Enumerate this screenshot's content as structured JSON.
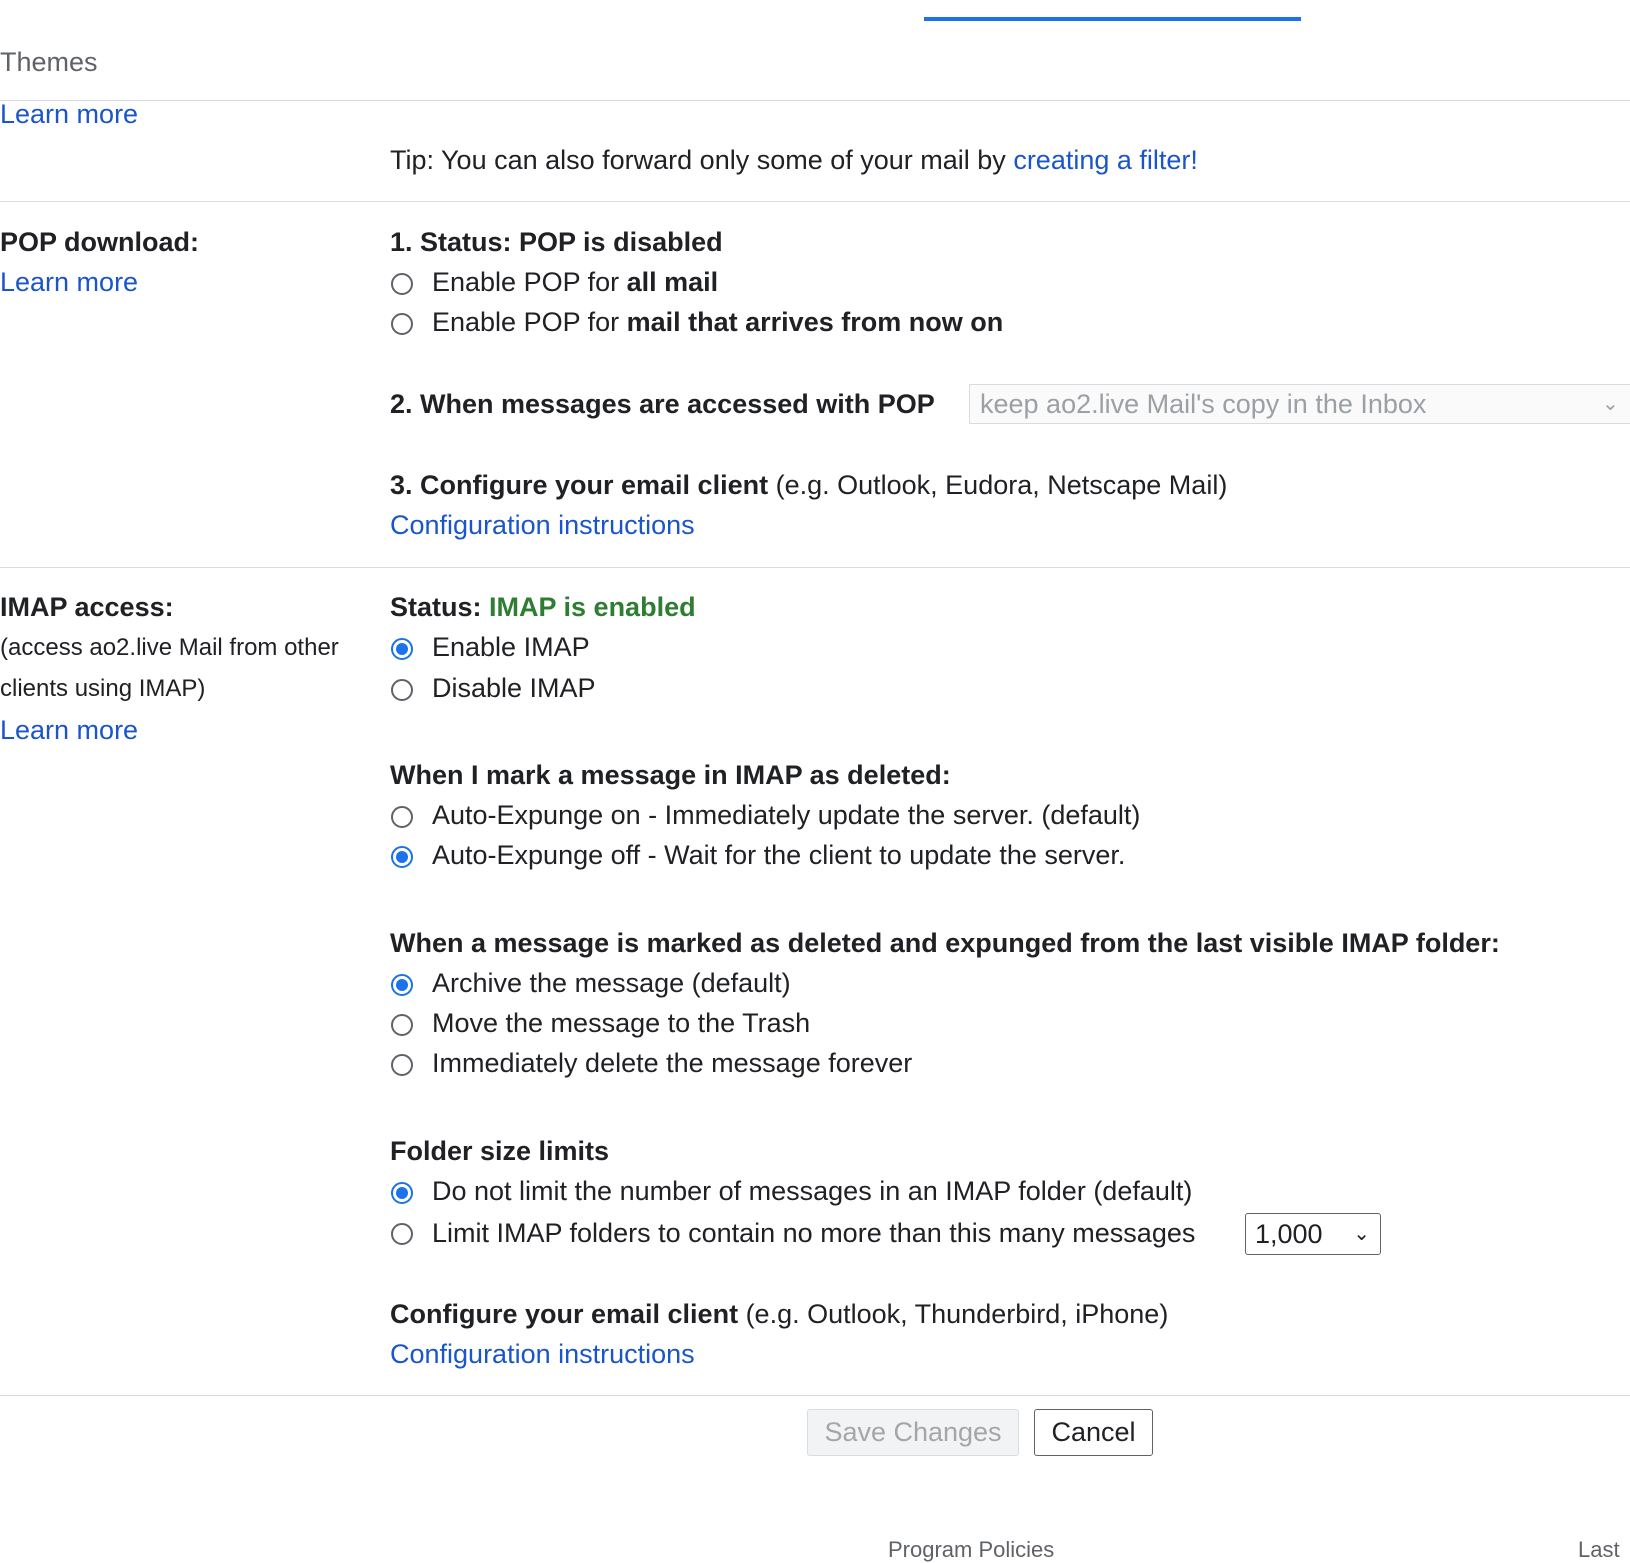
{
  "header": {
    "themes_tab": "Themes",
    "learn_more": "Learn more"
  },
  "forwarding": {
    "tip_prefix": "Tip: You can also forward only some of your mail by ",
    "tip_link": "creating a filter!"
  },
  "pop": {
    "label": "POP download:",
    "learn_more": "Learn more",
    "status": "1. Status: POP is disabled",
    "option_all_prefix": "Enable POP for ",
    "option_all_bold": "all mail",
    "option_now_prefix": "Enable POP for ",
    "option_now_bold": "mail that arrives from now on",
    "accessed_label": "2. When messages are accessed with POP",
    "accessed_value": "keep ao2.live Mail's copy in the Inbox",
    "configure_bold": "3. Configure your email client",
    "configure_rest": " (e.g. Outlook, Eudora, Netscape Mail)",
    "config_link": "Configuration instructions"
  },
  "imap": {
    "label": "IMAP access:",
    "desc_line1": "(access ao2.live Mail from other",
    "desc_line2": "clients using IMAP)",
    "learn_more": "Learn more",
    "status_prefix": "Status: ",
    "status_value": "IMAP is enabled",
    "enable": "Enable IMAP",
    "disable": "Disable IMAP",
    "deleted_heading": "When I mark a message in IMAP as deleted:",
    "expunge_on": "Auto-Expunge on - Immediately update the server. (default)",
    "expunge_off": "Auto-Expunge off - Wait for the client to update the server.",
    "expunged_heading": "When a message is marked as deleted and expunged from the last visible IMAP folder:",
    "archive": "Archive the message (default)",
    "trash": "Move the message to the Trash",
    "delete_forever": "Immediately delete the message forever",
    "folder_heading": "Folder size limits",
    "no_limit": "Do not limit the number of messages in an IMAP folder (default)",
    "limit": "Limit IMAP folders to contain no more than this many messages",
    "limit_value": "1,000",
    "configure_bold": "Configure your email client",
    "configure_rest": " (e.g. Outlook, Thunderbird, iPhone)",
    "config_link": "Configuration instructions"
  },
  "actions": {
    "save": "Save Changes",
    "cancel": "Cancel"
  },
  "footer": {
    "program_policies": "Program Policies",
    "last": "Last"
  },
  "colors": {
    "link": "#1a56c9",
    "accent": "#1a73e8",
    "enabled_green": "#2e7d32"
  }
}
